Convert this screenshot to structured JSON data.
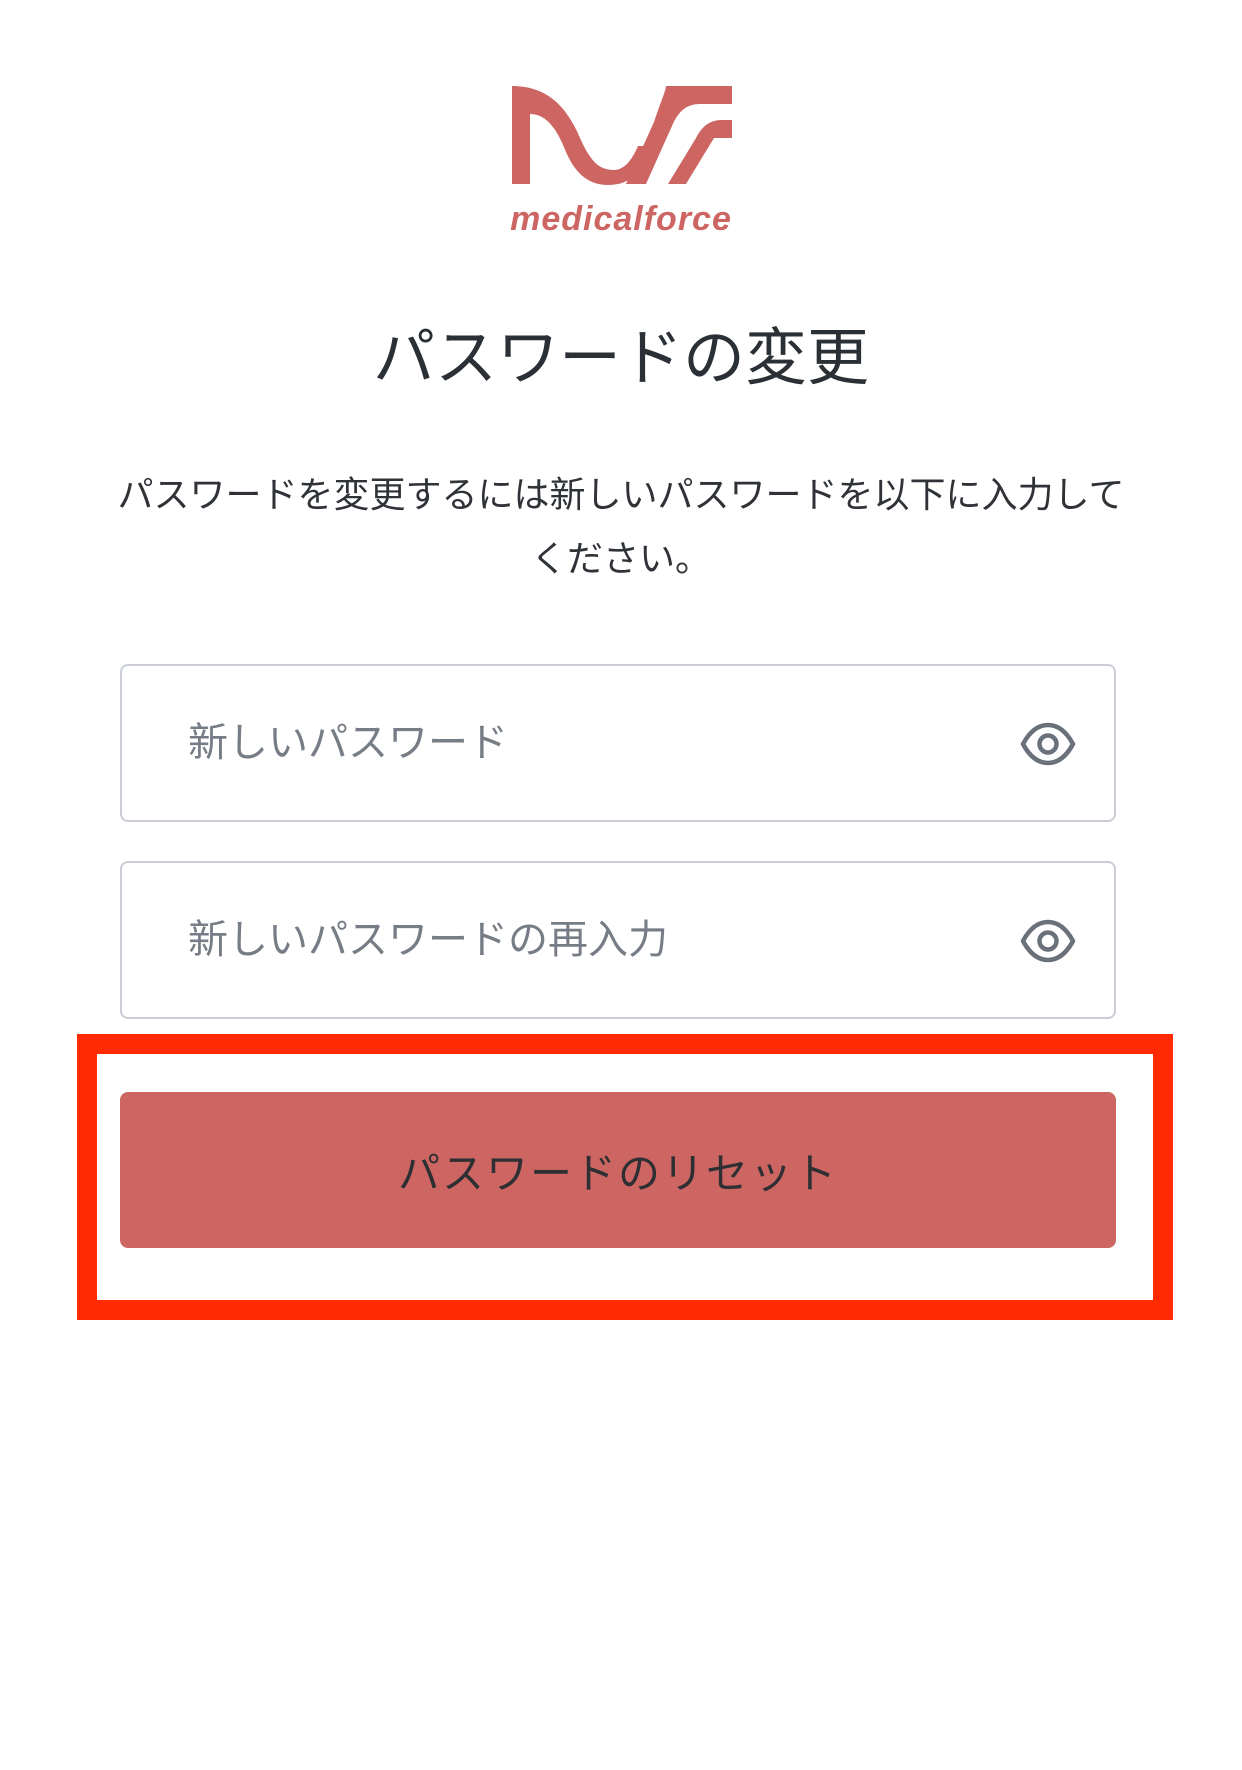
{
  "brand": {
    "name": "medicalforce",
    "color": "#cd6663"
  },
  "title": "パスワードの変更",
  "description": "パスワードを変更するには新しいパスワードを以下に入力してください。",
  "fields": {
    "new_password": {
      "placeholder": "新しいパスワード",
      "value": "",
      "toggle_icon": "eye-icon"
    },
    "confirm_password": {
      "placeholder": "新しいパスワードの再入力",
      "value": "",
      "toggle_icon": "eye-icon"
    }
  },
  "reset_button": {
    "label": "パスワードのリセット",
    "color": "#cd6663"
  },
  "highlight": {
    "color": "#ff2a00"
  }
}
